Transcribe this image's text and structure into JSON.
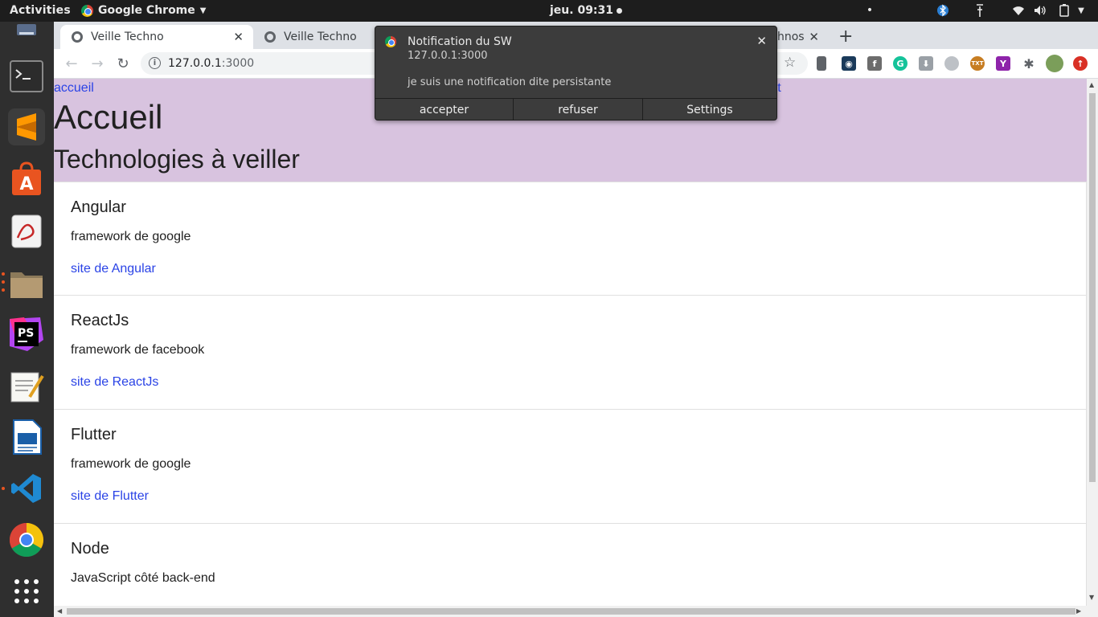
{
  "topbar": {
    "activities": "Activities",
    "app_name": "Google Chrome",
    "clock": "jeu. 09:31"
  },
  "dock": {
    "items": [
      "terminal-icon",
      "sublime-text-icon",
      "software-center-icon",
      "pdf-reader-icon",
      "files-icon",
      "phpstorm-icon",
      "text-editor-icon",
      "writer-icon",
      "vscode-icon",
      "chrome-icon",
      "app-grid-icon"
    ]
  },
  "browser": {
    "tabs": [
      {
        "label": "Veille Techno"
      },
      {
        "label": "Veille Techno"
      },
      {
        "label": "hnos"
      }
    ],
    "url_host": "127.0.0.1",
    "url_port": ":3000"
  },
  "notification": {
    "title": "Notification du SW",
    "origin": "127.0.0.1:3000",
    "body": "je suis une notification dite persistante",
    "actions": [
      "accepter",
      "refuser",
      "Settings"
    ]
  },
  "page": {
    "nav_home": "accueil",
    "nav_contact": "ntact",
    "title": "Accueil",
    "subtitle": "Technologies à veiller",
    "cards": [
      {
        "title": "Angular",
        "desc": "framework de google",
        "link": "site de Angular"
      },
      {
        "title": "ReactJs",
        "desc": "framework de facebook",
        "link": "site de ReactJs"
      },
      {
        "title": "Flutter",
        "desc": "framework de google",
        "link": "site de Flutter"
      },
      {
        "title": "Node",
        "desc": "JavaScript côté back-end",
        "link": ""
      }
    ]
  },
  "colors": {
    "header_bg": "#d8c3df",
    "link": "#2a43e6",
    "notification_bg": "#3c3c3c"
  }
}
